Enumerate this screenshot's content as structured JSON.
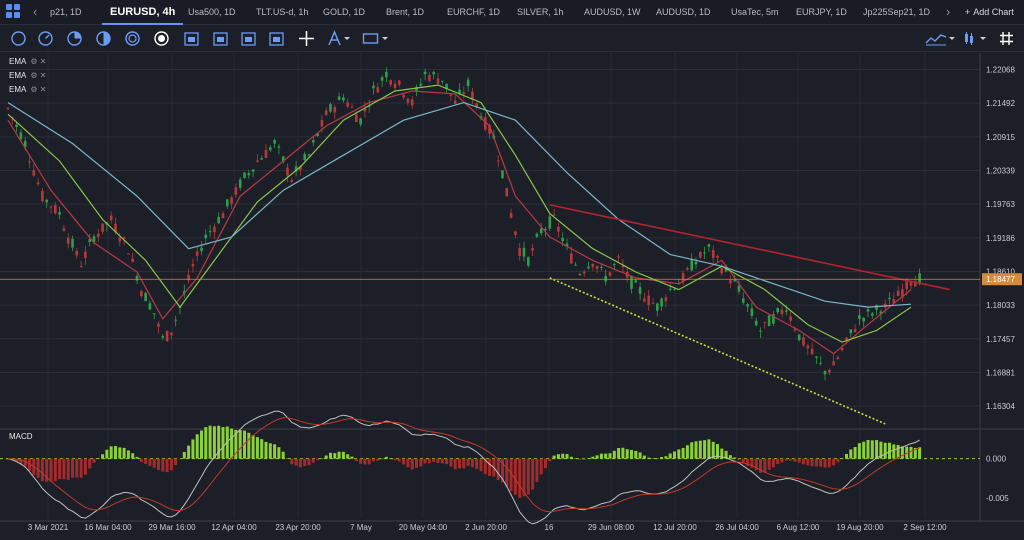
{
  "tabbar": {
    "nav_left": "‹",
    "nav_right": "›",
    "add_chart": "Add Chart",
    "add_chart_plus": "+",
    "tabs": [
      {
        "label": "p21, 1D",
        "active": false
      },
      {
        "label": "EURUSD, 4h",
        "active": true
      },
      {
        "label": "Usa500, 1D",
        "active": false
      },
      {
        "label": "TLT.US-d, 1h",
        "active": false
      },
      {
        "label": "GOLD, 1D",
        "active": false
      },
      {
        "label": "Brent, 1D",
        "active": false
      },
      {
        "label": "EURCHF, 1D",
        "active": false
      },
      {
        "label": "SILVER, 1h",
        "active": false
      },
      {
        "label": "AUDUSD, 1W",
        "active": false
      },
      {
        "label": "AUDUSD, 1D",
        "active": false
      },
      {
        "label": "UsaTec, 5m",
        "active": false
      },
      {
        "label": "EURJPY, 1D",
        "active": false
      },
      {
        "label": "Jp225Sep21, 1D",
        "active": false
      }
    ]
  },
  "toolbar": {
    "tools": [
      "circle-icon",
      "gauge-icon",
      "pie-icon",
      "half-moon-icon",
      "coin-icon",
      "record-icon",
      "calendar-icon",
      "calendar-icon",
      "calendar-icon",
      "calendar-icon",
      "crosshair-icon",
      "pen-icon",
      "rectangle-icon"
    ],
    "right_tools": [
      "chart-type-icon",
      "candle-icon",
      "more-icon",
      "grid-icon"
    ]
  },
  "legend": {
    "ema_rows": [
      "EMA",
      "EMA",
      "EMA"
    ],
    "indicator_pane": "MACD"
  },
  "colors": {
    "background": "#1c1f28",
    "candle_up": "#2e9e4a",
    "candle_down": "#b53a3a",
    "ema_fast": "#b83a44",
    "ema_mid": "#8bc34a",
    "ema_slow": "#7ab8c6",
    "trendline_down": "#b3232f",
    "trendline_support": "#c8e03a",
    "price_line": "#d28c3c",
    "price_tag": "#d28c3c"
  },
  "chart_data": {
    "type": "candlestick",
    "symbol": "EURUSD",
    "timeframe": "4h",
    "y_ticks": [
      "1.22068",
      "1.21492",
      "1.20915",
      "1.20339",
      "1.19763",
      "1.19186",
      "1.18610",
      "1.18033",
      "1.17457",
      "1.16881",
      "1.16304"
    ],
    "current_price": "1.18477",
    "x_ticks": [
      "3 Mar 2021",
      "16 Mar 04:00",
      "29 Mar 16:00",
      "12 Apr 04:00",
      "23 Apr 20:00",
      "7 May",
      "20 May 04:00",
      "2 Jun 20:00",
      "16",
      "29 Jun 08:00",
      "12 Jul 20:00",
      "26 Jul 04:00",
      "6 Aug 12:00",
      "19 Aug 20:00",
      "2 Sep 12:00"
    ],
    "ylim": [
      1.1593,
      1.2235
    ],
    "price_path": [
      [
        0,
        1.214
      ],
      [
        4,
        1.208
      ],
      [
        8,
        1.199
      ],
      [
        12,
        1.196
      ],
      [
        14,
        1.192
      ],
      [
        17,
        1.1875
      ],
      [
        20,
        1.192
      ],
      [
        24,
        1.195
      ],
      [
        28,
        1.19
      ],
      [
        31,
        1.183
      ],
      [
        34,
        1.179
      ],
      [
        36,
        1.1745
      ],
      [
        38,
        1.176
      ],
      [
        40,
        1.18
      ],
      [
        43,
        1.187
      ],
      [
        46,
        1.192
      ],
      [
        50,
        1.196
      ],
      [
        54,
        1.201
      ],
      [
        58,
        1.205
      ],
      [
        62,
        1.208
      ],
      [
        66,
        1.202
      ],
      [
        70,
        1.206
      ],
      [
        74,
        1.213
      ],
      [
        78,
        1.216
      ],
      [
        82,
        1.212
      ],
      [
        85,
        1.217
      ],
      [
        88,
        1.22
      ],
      [
        91,
        1.218
      ],
      [
        94,
        1.215
      ],
      [
        97,
        1.22
      ],
      [
        101,
        1.219
      ],
      [
        104,
        1.215
      ],
      [
        107,
        1.218
      ],
      [
        110,
        1.213
      ],
      [
        113,
        1.209
      ],
      [
        115,
        1.203
      ],
      [
        117,
        1.196
      ],
      [
        119,
        1.19
      ],
      [
        121,
        1.188
      ],
      [
        124,
        1.193
      ],
      [
        127,
        1.195
      ],
      [
        130,
        1.19
      ],
      [
        133,
        1.186
      ],
      [
        136,
        1.188
      ],
      [
        139,
        1.185
      ],
      [
        142,
        1.188
      ],
      [
        145,
        1.184
      ],
      [
        148,
        1.182
      ],
      [
        151,
        1.18
      ],
      [
        154,
        1.183
      ],
      [
        157,
        1.185
      ],
      [
        160,
        1.188
      ],
      [
        163,
        1.19
      ],
      [
        166,
        1.187
      ],
      [
        169,
        1.184
      ],
      [
        172,
        1.18
      ],
      [
        175,
        1.176
      ],
      [
        178,
        1.178
      ],
      [
        181,
        1.18
      ],
      [
        184,
        1.175
      ],
      [
        187,
        1.172
      ],
      [
        190,
        1.169
      ],
      [
        192,
        1.17
      ],
      [
        195,
        1.174
      ],
      [
        198,
        1.178
      ],
      [
        201,
        1.179
      ],
      [
        204,
        1.18
      ],
      [
        207,
        1.182
      ],
      [
        210,
        1.1848
      ]
    ],
    "series": [
      {
        "name": "EMA",
        "values": [
          [
            0,
            1.212
          ],
          [
            10,
            1.2
          ],
          [
            20,
            1.191
          ],
          [
            30,
            1.186
          ],
          [
            36,
            1.178
          ],
          [
            44,
            1.185
          ],
          [
            54,
            1.199
          ],
          [
            64,
            1.205
          ],
          [
            74,
            1.211
          ],
          [
            84,
            1.215
          ],
          [
            94,
            1.217
          ],
          [
            104,
            1.2165
          ],
          [
            112,
            1.211
          ],
          [
            118,
            1.199
          ],
          [
            126,
            1.192
          ],
          [
            136,
            1.188
          ],
          [
            146,
            1.185
          ],
          [
            156,
            1.184
          ],
          [
            166,
            1.188
          ],
          [
            174,
            1.18
          ],
          [
            184,
            1.176
          ],
          [
            192,
            1.172
          ],
          [
            200,
            1.177
          ],
          [
            210,
            1.183
          ]
        ]
      },
      {
        "name": "EMA",
        "values": [
          [
            0,
            1.213
          ],
          [
            12,
            1.205
          ],
          [
            22,
            1.195
          ],
          [
            32,
            1.188
          ],
          [
            40,
            1.18
          ],
          [
            48,
            1.188
          ],
          [
            58,
            1.198
          ],
          [
            68,
            1.204
          ],
          [
            78,
            1.212
          ],
          [
            90,
            1.217
          ],
          [
            100,
            1.218
          ],
          [
            110,
            1.215
          ],
          [
            118,
            1.206
          ],
          [
            126,
            1.196
          ],
          [
            136,
            1.19
          ],
          [
            146,
            1.186
          ],
          [
            156,
            1.183
          ],
          [
            166,
            1.187
          ],
          [
            176,
            1.183
          ],
          [
            186,
            1.177
          ],
          [
            194,
            1.174
          ],
          [
            202,
            1.176
          ],
          [
            210,
            1.18
          ]
        ]
      },
      {
        "name": "EMA",
        "values": [
          [
            0,
            1.215
          ],
          [
            15,
            1.208
          ],
          [
            30,
            1.199
          ],
          [
            42,
            1.19
          ],
          [
            52,
            1.192
          ],
          [
            64,
            1.2
          ],
          [
            78,
            1.206
          ],
          [
            92,
            1.212
          ],
          [
            106,
            1.215
          ],
          [
            118,
            1.212
          ],
          [
            130,
            1.203
          ],
          [
            142,
            1.195
          ],
          [
            154,
            1.189
          ],
          [
            166,
            1.187
          ],
          [
            178,
            1.184
          ],
          [
            190,
            1.181
          ],
          [
            200,
            1.18
          ],
          [
            210,
            1.1805
          ]
        ]
      }
    ],
    "trendlines": [
      {
        "name": "resistance",
        "from": [
          126,
          1.1975
        ],
        "to": [
          219,
          1.183
        ]
      },
      {
        "name": "support",
        "from": [
          126,
          1.185
        ],
        "to": [
          204,
          1.16
        ]
      }
    ],
    "macd": {
      "y_ticks": [
        "0.000",
        "-0.005"
      ],
      "ylim": [
        -0.0075,
        0.0035
      ]
    }
  }
}
